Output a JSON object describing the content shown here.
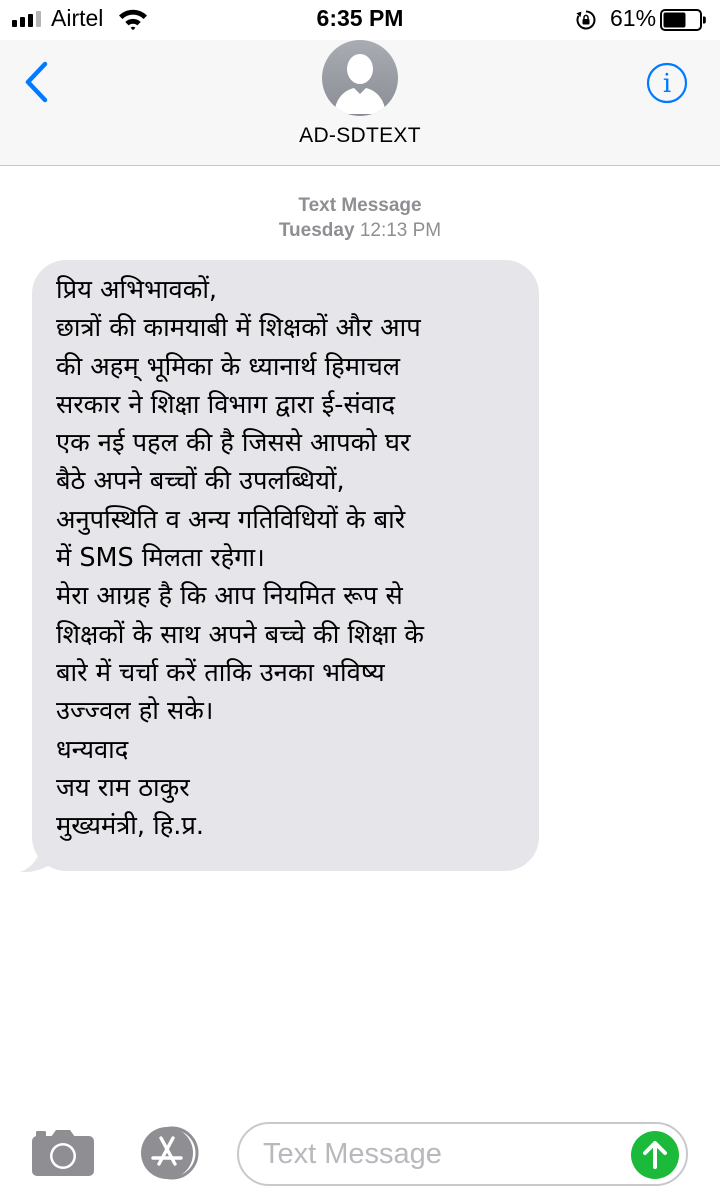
{
  "status_bar": {
    "carrier": "Airtel",
    "time": "6:35 PM",
    "battery_percent": "61%",
    "battery_level": 0.61,
    "signal_bars": 3,
    "signal_bars_total": 4
  },
  "header": {
    "back_icon": "chevron-left-icon",
    "avatar_icon": "person-silhouette-icon",
    "contact_name": "AD-SDTEXT",
    "info_icon": "info-icon"
  },
  "thread": {
    "service_label": "Text Message",
    "day": "Tuesday",
    "time": "12:13 PM"
  },
  "message": {
    "lines": [
      "प्रिय अभिभावकों,",
      "छात्रों की कामयाबी में शिक्षकों और आप",
      "की अहम् भूमिका के ध्यानार्थ हिमाचल",
      "सरकार ने शिक्षा विभाग द्वारा ई-संवाद",
      "एक नई पहल की है जिससे आपको घर",
      "बैठे अपने बच्चों की उपलब्धियों,",
      "अनुपस्थिति व अन्य गतिविधियों के बारे",
      "में SMS मिलता रहेगा।",
      "मेरा आग्रह है कि आप नियमित रूप से",
      "शिक्षकों के साथ अपने बच्चे की शिक्षा के",
      "बारे में चर्चा करें ताकि उनका भविष्य",
      "उज्ज्वल हो सके।",
      "धन्यवाद",
      "जय राम ठाकुर",
      "मुख्यमंत्री, हि.प्र."
    ]
  },
  "composer": {
    "camera_icon": "camera-icon",
    "apps_icon": "app-store-icon",
    "placeholder": "Text Message",
    "send_icon": "send-arrow-icon"
  },
  "colors": {
    "accent": "#007aff",
    "bubble_incoming": "#e5e5ea",
    "send_button": "#1bba3a",
    "muted_text": "#8e8e93"
  }
}
